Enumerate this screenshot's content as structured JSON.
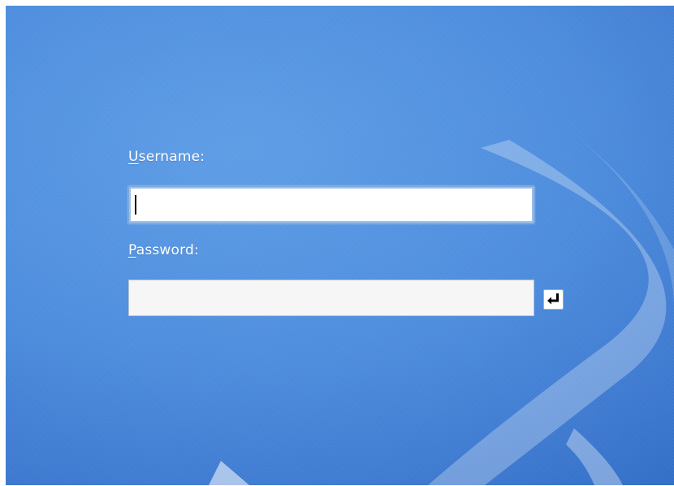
{
  "login": {
    "username_label_accel": "U",
    "username_label_rest": "sername:",
    "username_value": "",
    "password_label_accel": "P",
    "password_label_rest": "assword:",
    "password_value": ""
  },
  "icons": {
    "submit": "enter-arrow-icon"
  },
  "colors": {
    "background": "#4f8fe0",
    "label_text": "#ffffff",
    "field_focus_border": "#9cc0ea"
  }
}
